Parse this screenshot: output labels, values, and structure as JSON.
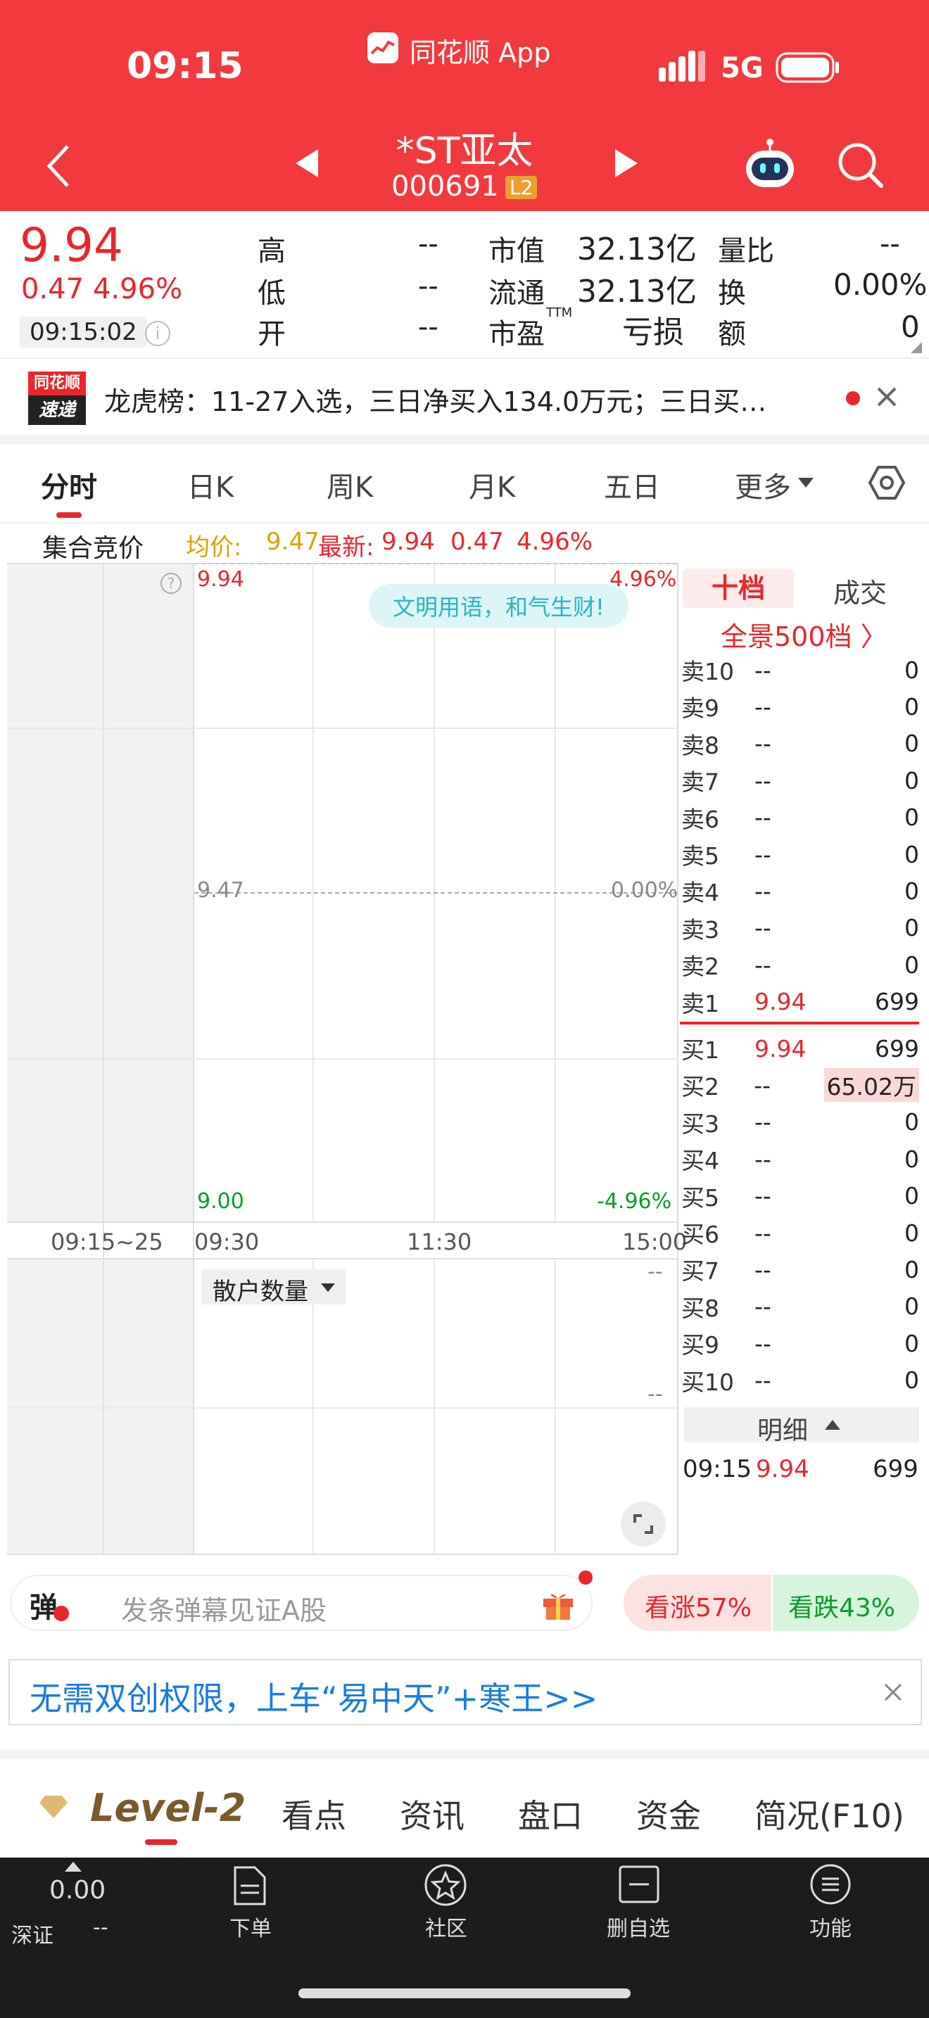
{
  "status_bar": {
    "time": "09:15",
    "app_label": "同花顺 App",
    "network": "5G"
  },
  "header": {
    "stock_name": "*ST亚太",
    "stock_code": "000691",
    "level_badge": "L2"
  },
  "quote": {
    "price": "9.94",
    "change": "0.47",
    "change_pct": "4.96%",
    "time": "09:15:02",
    "high_label": "高",
    "high": "--",
    "low_label": "低",
    "low": "--",
    "open_label": "开",
    "open": "--",
    "mktcap_label": "市值",
    "mktcap": "32.13亿",
    "float_label": "流通",
    "float": "32.13亿",
    "pe_label": "市盈",
    "pe_sup": "TTM",
    "pe": "亏损",
    "volratio_label": "量比",
    "volratio": "--",
    "turnover_label": "换",
    "turnover": "0.00%",
    "amount_label": "额",
    "amount": "0"
  },
  "news": {
    "badge_top": "同花顺",
    "badge_bottom": "速递",
    "text": "龙虎榜：11-27入选，三日净买入134.0万元；三日买…"
  },
  "tabs": [
    {
      "label": "分时"
    },
    {
      "label": "日K"
    },
    {
      "label": "周K"
    },
    {
      "label": "月K"
    },
    {
      "label": "五日"
    },
    {
      "label": "更多"
    }
  ],
  "auction": {
    "label": "集合竞价",
    "avg_label": "均价:",
    "avg": "9.47",
    "latest_label": "最新:",
    "latest": "9.94",
    "change": "0.47",
    "change_pct": "4.96%"
  },
  "chart": {
    "y_top": "9.94",
    "y_mid": "9.47",
    "y_bot": "9.00",
    "pct_top": "4.96%",
    "pct_mid": "0.00%",
    "pct_bot": "-4.96%",
    "x_auction": "09:15~25",
    "x_start": "09:30",
    "x_mid": "11:30",
    "x_end": "15:00",
    "tip": "文明用语，和气生财!",
    "sub_selector": "散户数量",
    "sub_dash1": "--",
    "sub_dash2": "--"
  },
  "orderbook": {
    "tab_active": "十档",
    "tab_other": "成交",
    "panorama": "全景500档 〉",
    "sells": [
      {
        "label": "卖10",
        "price": "--",
        "vol": "0"
      },
      {
        "label": "卖9",
        "price": "--",
        "vol": "0"
      },
      {
        "label": "卖8",
        "price": "--",
        "vol": "0"
      },
      {
        "label": "卖7",
        "price": "--",
        "vol": "0"
      },
      {
        "label": "卖6",
        "price": "--",
        "vol": "0"
      },
      {
        "label": "卖5",
        "price": "--",
        "vol": "0"
      },
      {
        "label": "卖4",
        "price": "--",
        "vol": "0"
      },
      {
        "label": "卖3",
        "price": "--",
        "vol": "0"
      },
      {
        "label": "卖2",
        "price": "--",
        "vol": "0"
      },
      {
        "label": "卖1",
        "price": "9.94",
        "vol": "699"
      }
    ],
    "buys": [
      {
        "label": "买1",
        "price": "9.94",
        "vol": "699"
      },
      {
        "label": "买2",
        "price": "--",
        "vol": "65.02万"
      },
      {
        "label": "买3",
        "price": "--",
        "vol": "0"
      },
      {
        "label": "买4",
        "price": "--",
        "vol": "0"
      },
      {
        "label": "买5",
        "price": "--",
        "vol": "0"
      },
      {
        "label": "买6",
        "price": "--",
        "vol": "0"
      },
      {
        "label": "买7",
        "price": "--",
        "vol": "0"
      },
      {
        "label": "买8",
        "price": "--",
        "vol": "0"
      },
      {
        "label": "买9",
        "price": "--",
        "vol": "0"
      },
      {
        "label": "买10",
        "price": "--",
        "vol": "0"
      }
    ],
    "detail_label": "明细",
    "detail": {
      "time": "09:15",
      "price": "9.94",
      "vol": "699"
    }
  },
  "danmaku": {
    "icon": "弹",
    "placeholder": "发条弹幕见证A股",
    "up": "看涨57%",
    "down": "看跌43%"
  },
  "promo": {
    "text": "无需双创权限，上车“易中天”+寒王>>"
  },
  "bottom_tabs": [
    {
      "label": "Level-2"
    },
    {
      "label": "看点"
    },
    {
      "label": "资讯"
    },
    {
      "label": "盘口"
    },
    {
      "label": "资金"
    },
    {
      "label": "简况(F10)"
    }
  ],
  "nav": {
    "index_value": "0.00",
    "index_name": "深证",
    "index_dash": "--",
    "items": [
      {
        "label": "下单"
      },
      {
        "label": "社区"
      },
      {
        "label": "删自选"
      },
      {
        "label": "功能"
      }
    ]
  },
  "colors": {
    "brand": "#f23a3e",
    "up": "#e8262c",
    "down": "#0a9c2a",
    "avg": "#d5a500"
  }
}
